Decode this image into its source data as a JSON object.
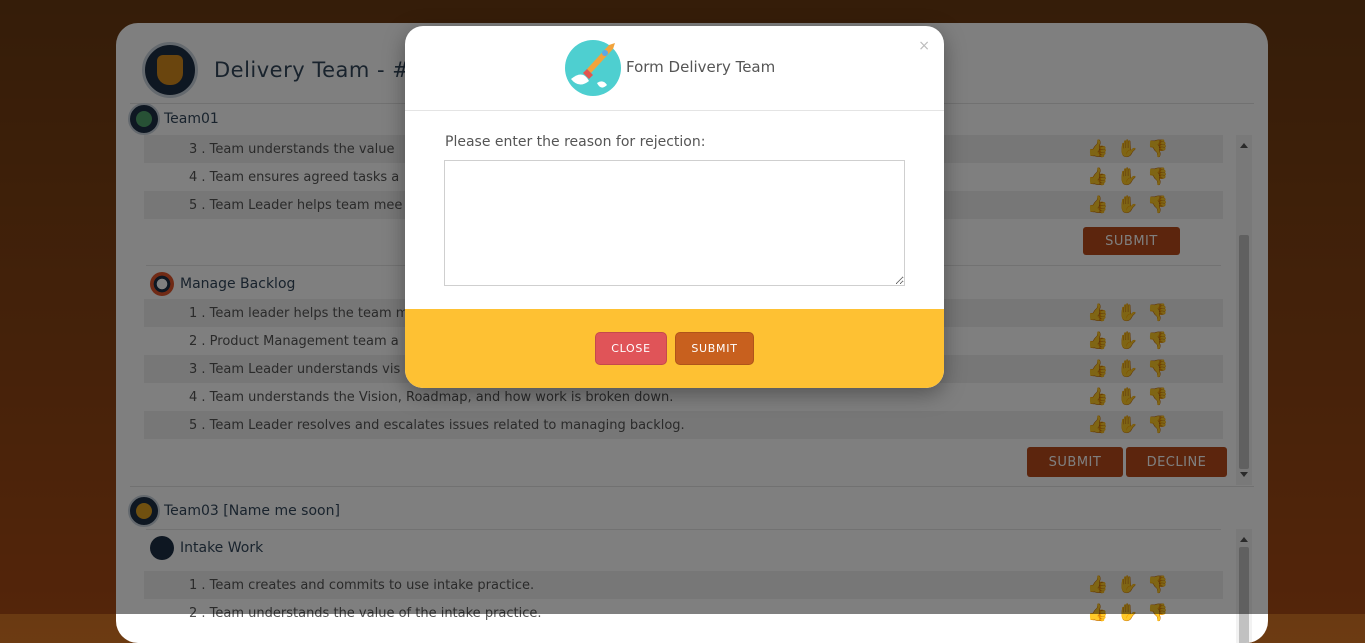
{
  "header": {
    "title": "Delivery Team - #"
  },
  "team1": {
    "name": "Team01",
    "rows": [
      "3 . Team understands the value",
      "4 . Team ensures agreed tasks a",
      "5 . Team Leader helps team mee"
    ],
    "submit_label": "SUBMIT",
    "section2": {
      "title": "Manage Backlog",
      "rows": [
        "1 . Team leader helps the team m",
        "2 . Product Management team a",
        "3 . Team Leader understands vis",
        "4 . Team understands the Vision, Roadmap, and how work is broken down.",
        "5 . Team Leader resolves and escalates issues related to managing backlog."
      ],
      "submit_label": "SUBMIT",
      "decline_label": "DECLINE"
    }
  },
  "team3": {
    "name": "Team03 [Name me soon]",
    "section": {
      "title": "Intake Work",
      "rows": [
        "1 . Team creates and commits to use intake practice.",
        "2 . Team understands the value of the intake practice."
      ]
    }
  },
  "modal": {
    "title": "Form Delivery Team",
    "close_x": "×",
    "label": "Please enter the reason for rejection:",
    "textarea_value": "",
    "close_label": "CLOSE",
    "submit_label": "SUBMIT"
  },
  "colors": {
    "accent": "#b84a1a",
    "modal_footer": "#fec133",
    "close_button": "#e05458",
    "submit_button": "#c8601e"
  },
  "icons": [
    "thumbs-up-icon",
    "thumbs-sideways-icon",
    "thumbs-down-icon",
    "rocket-logo-icon",
    "team-logo-icon"
  ]
}
